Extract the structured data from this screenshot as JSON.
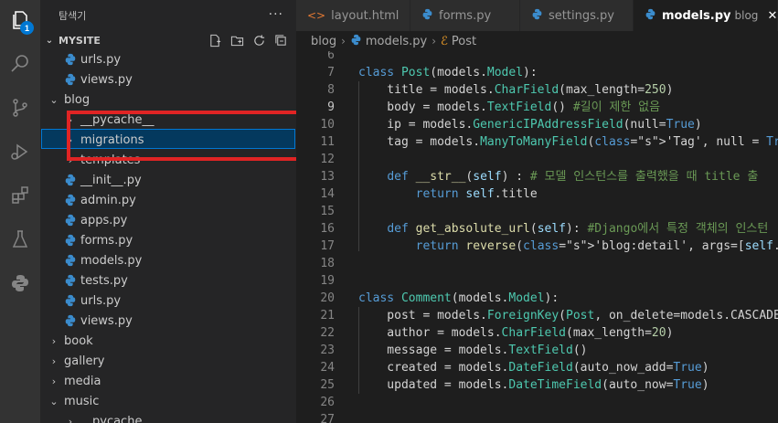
{
  "activity": {
    "items": [
      "explorer-icon",
      "search-icon",
      "source-control-icon",
      "run-debug-icon",
      "extensions-icon",
      "testing-icon",
      "python-icon"
    ],
    "explorer_badge": "1"
  },
  "sidebar": {
    "title": "탐색기",
    "more": "···",
    "section": "MYSITE",
    "tree": [
      {
        "label": "urls.py",
        "kind": "py"
      },
      {
        "label": "views.py",
        "kind": "py"
      },
      {
        "label": "blog",
        "kind": "folder-open"
      },
      {
        "label": "__pycache__",
        "kind": "folder"
      },
      {
        "label": "migrations",
        "kind": "folder"
      },
      {
        "label": "templates",
        "kind": "folder"
      },
      {
        "label": "__init__.py",
        "kind": "py"
      },
      {
        "label": "admin.py",
        "kind": "py"
      },
      {
        "label": "apps.py",
        "kind": "py"
      },
      {
        "label": "forms.py",
        "kind": "py"
      },
      {
        "label": "models.py",
        "kind": "py"
      },
      {
        "label": "tests.py",
        "kind": "py"
      },
      {
        "label": "urls.py",
        "kind": "py"
      },
      {
        "label": "views.py",
        "kind": "py"
      },
      {
        "label": "book",
        "kind": "folder"
      },
      {
        "label": "gallery",
        "kind": "folder"
      },
      {
        "label": "media",
        "kind": "folder"
      },
      {
        "label": "music",
        "kind": "folder-open"
      },
      {
        "label": "__pycache__",
        "kind": "folder"
      }
    ]
  },
  "tabs": [
    {
      "label": "layout.html",
      "icon": "<>",
      "active": false
    },
    {
      "label": "forms.py",
      "icon": "py",
      "active": false
    },
    {
      "label": "settings.py",
      "icon": "py",
      "active": false
    },
    {
      "label": "models.py",
      "desc": "blog",
      "icon": "py",
      "active": true,
      "close": "✕"
    }
  ],
  "breadcrumb": {
    "folder": "blog",
    "file": "models.py",
    "symbol": "Post"
  },
  "code": {
    "current_line": "9",
    "lines": [
      {
        "n": "6",
        "t": ""
      },
      {
        "n": "7",
        "t": "class Post(models.Model):"
      },
      {
        "n": "8",
        "t": "    title = models.CharField(max_length=250)"
      },
      {
        "n": "9",
        "t": "    body = models.TextField() #길이 제한 없음"
      },
      {
        "n": "10",
        "t": "    ip = models.GenericIPAddressField(null=True)"
      },
      {
        "n": "11",
        "t": "    tag = models.ManyToManyField('Tag', null = True, blank ="
      },
      {
        "n": "12",
        "t": ""
      },
      {
        "n": "13",
        "t": "    def __str__(self) : # 모델 인스턴스를 출력했을 때 title 출"
      },
      {
        "n": "14",
        "t": "        return self.title"
      },
      {
        "n": "15",
        "t": ""
      },
      {
        "n": "16",
        "t": "    def get_absolute_url(self): #Django에서 특정 객체의 인스턴"
      },
      {
        "n": "17",
        "t": "        return reverse('blog:detail', args=[self.id])"
      },
      {
        "n": "18",
        "t": ""
      },
      {
        "n": "19",
        "t": ""
      },
      {
        "n": "20",
        "t": "class Comment(models.Model):"
      },
      {
        "n": "21",
        "t": "    post = models.ForeignKey(Post, on_delete=models.CASCADE,"
      },
      {
        "n": "22",
        "t": "    author = models.CharField(max_length=20)"
      },
      {
        "n": "23",
        "t": "    message = models.TextField()"
      },
      {
        "n": "24",
        "t": "    created = models.DateField(auto_now_add=True)"
      },
      {
        "n": "25",
        "t": "    updated = models.DateTimeField(auto_now=True)"
      },
      {
        "n": "26",
        "t": ""
      },
      {
        "n": "27",
        "t": ""
      }
    ]
  },
  "colors": {
    "accent": "#0078d4",
    "highlight_box": "#e02424",
    "python_icon": "#3b8ccd"
  }
}
